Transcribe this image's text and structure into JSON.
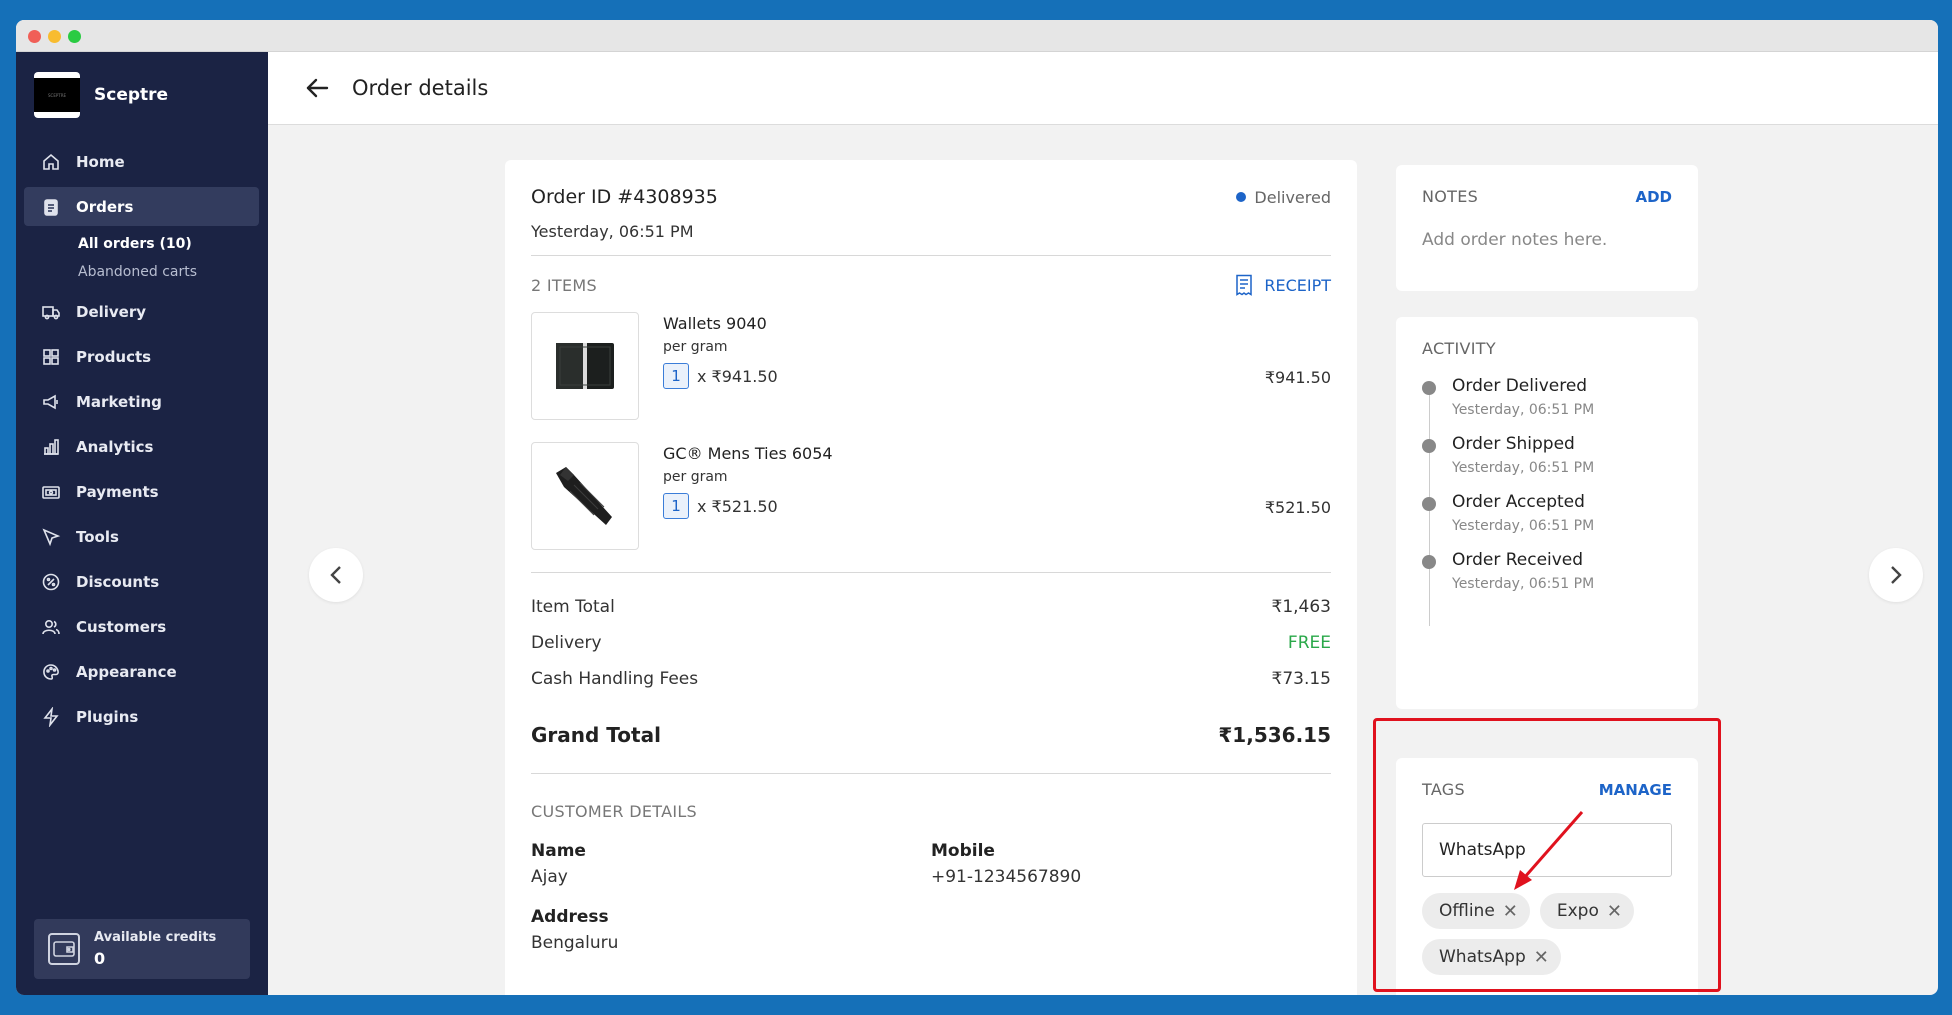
{
  "sidebar": {
    "brand": "Sceptre",
    "brand_logo_text": "SCEPTRE",
    "items": [
      {
        "label": "Home",
        "icon": "home-icon"
      },
      {
        "label": "Orders",
        "icon": "orders-icon"
      },
      {
        "label": "Delivery",
        "icon": "delivery-truck-icon"
      },
      {
        "label": "Products",
        "icon": "products-grid-icon"
      },
      {
        "label": "Marketing",
        "icon": "megaphone-icon"
      },
      {
        "label": "Analytics",
        "icon": "bar-chart-icon"
      },
      {
        "label": "Payments",
        "icon": "payments-icon"
      },
      {
        "label": "Tools",
        "icon": "cursor-icon"
      },
      {
        "label": "Discounts",
        "icon": "discount-badge-icon"
      },
      {
        "label": "Customers",
        "icon": "customers-icon"
      },
      {
        "label": "Appearance",
        "icon": "palette-icon"
      },
      {
        "label": "Plugins",
        "icon": "lightning-icon"
      }
    ],
    "subitems": [
      "All orders (10)",
      "Abandoned carts"
    ],
    "credits": {
      "label": "Available credits",
      "value": "0"
    }
  },
  "header": {
    "title": "Order details"
  },
  "order": {
    "id": "Order ID #4308935",
    "status": "Delivered",
    "date": "Yesterday, 06:51 PM",
    "items_count": "2 ITEMS",
    "receipt_label": "RECEIPT",
    "items": [
      {
        "name": "Wallets 9040",
        "unit": "per gram",
        "qty": "1",
        "unit_price": "x ₹941.50",
        "price": "₹941.50"
      },
      {
        "name": "GC® Mens Ties 6054",
        "unit": "per gram",
        "qty": "1",
        "unit_price": "x ₹521.50",
        "price": "₹521.50"
      }
    ],
    "summary": {
      "item_total_label": "Item Total",
      "item_total": "₹1,463",
      "delivery_label": "Delivery",
      "delivery": "FREE",
      "cash_label": "Cash Handling Fees",
      "cash": "₹73.15",
      "grand_label": "Grand Total",
      "grand": "₹1,536.15"
    },
    "customer": {
      "heading": "CUSTOMER DETAILS",
      "name_label": "Name",
      "name": "Ajay",
      "mobile_label": "Mobile",
      "mobile": "+91-1234567890",
      "address_label": "Address",
      "address": "Bengaluru"
    }
  },
  "notes": {
    "title": "NOTES",
    "action": "ADD",
    "placeholder": "Add order notes here."
  },
  "activity": {
    "title": "ACTIVITY",
    "events": [
      {
        "title": "Order Delivered",
        "time": "Yesterday, 06:51 PM"
      },
      {
        "title": "Order Shipped",
        "time": "Yesterday, 06:51 PM"
      },
      {
        "title": "Order Accepted",
        "time": "Yesterday, 06:51 PM"
      },
      {
        "title": "Order Received",
        "time": "Yesterday, 06:51 PM"
      }
    ]
  },
  "tags": {
    "title": "TAGS",
    "action": "MANAGE",
    "input_value": "WhatsApp",
    "chips": [
      "Offline",
      "Expo",
      "WhatsApp"
    ]
  },
  "colors": {
    "accent": "#1d64c8",
    "sidebar": "#1b2344",
    "free": "#2aa84a",
    "annotation": "#e0121e"
  }
}
